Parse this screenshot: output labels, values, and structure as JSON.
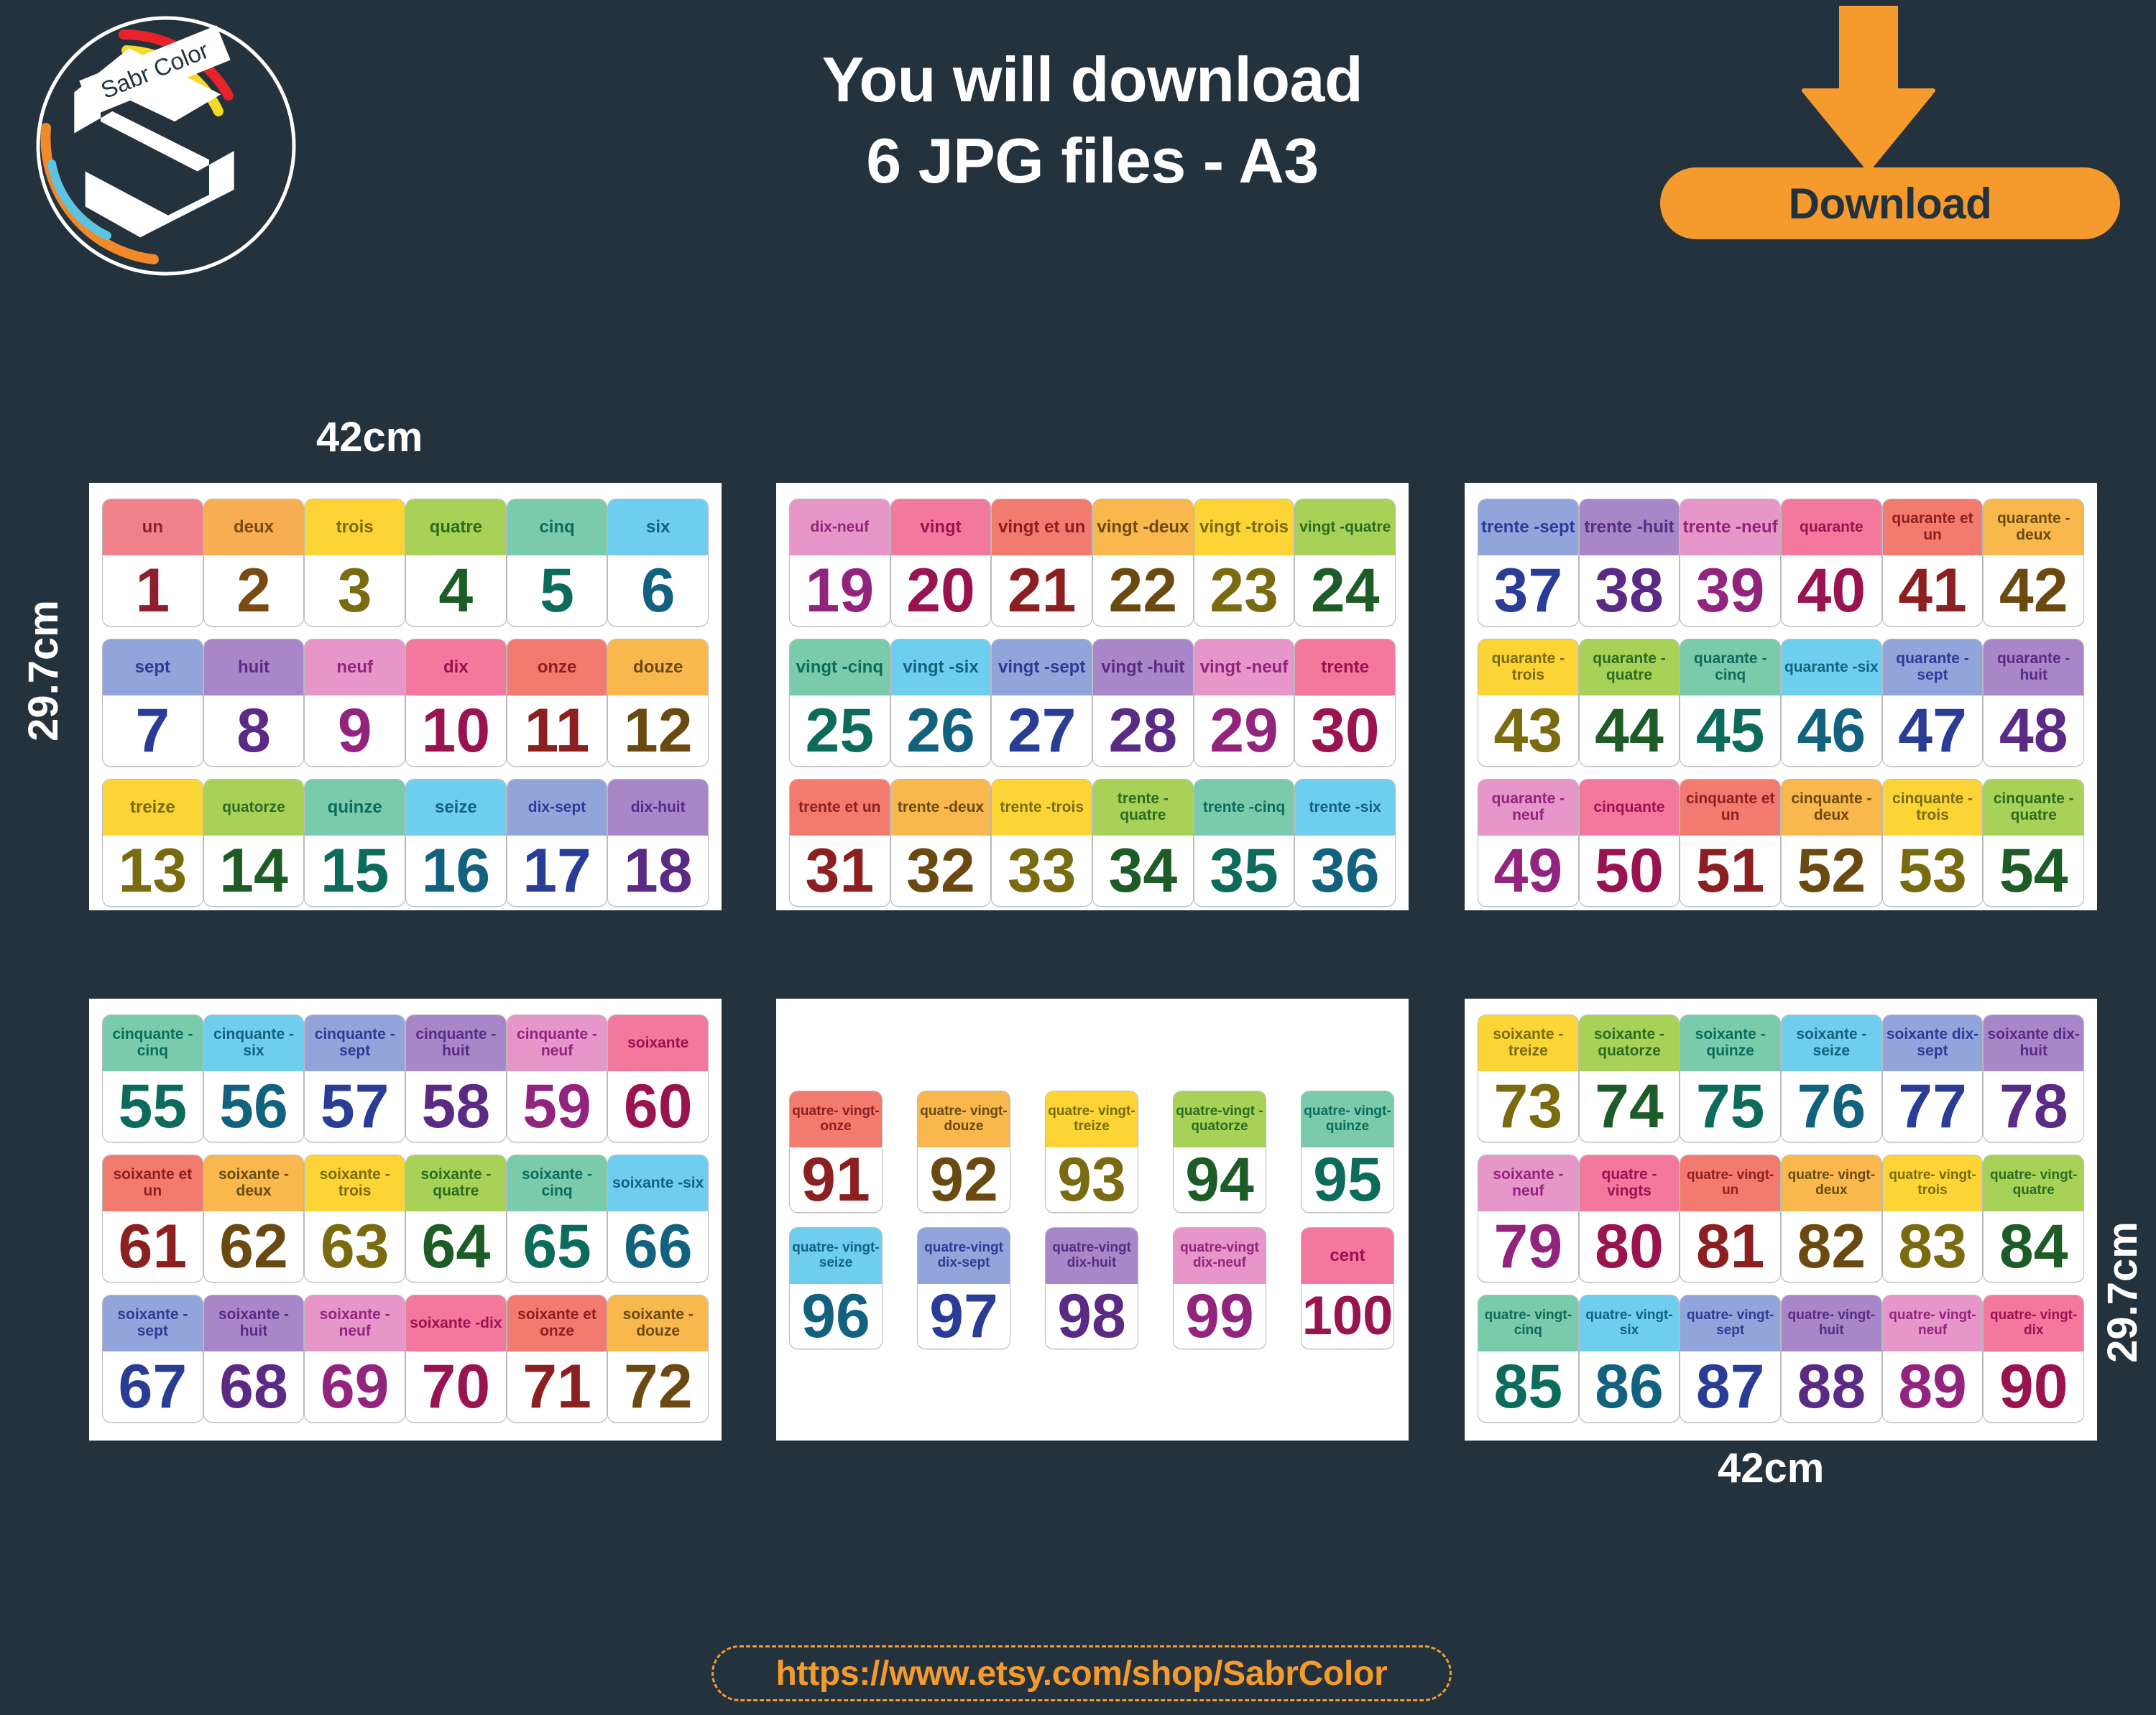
{
  "brand": {
    "logo_text": "Sabr Color",
    "logo_arc_colors": [
      "#e8242a",
      "#f5d828",
      "#f0892a",
      "#5cc4e0"
    ]
  },
  "header": {
    "line1": "You will download",
    "line2": "6 JPG files - A3"
  },
  "download": {
    "label": "Download",
    "button_color": "#f59a2c",
    "arrow_color": "#f59a2c"
  },
  "dimensions": {
    "top_left_width": "42cm",
    "left_height": "29.7cm",
    "bottom_right_width": "42cm",
    "right_height": "29.7cm"
  },
  "footer": {
    "url": "https://www.etsy.com/shop/SabrColor",
    "accent": "#f59a2c"
  },
  "palette": {
    "head_bg": [
      "#f0808a",
      "#f7ad52",
      "#fad535",
      "#a8d257",
      "#7acbab",
      "#6fcdee",
      "#92a5da",
      "#a886c8",
      "#e696c8",
      "#f2789e",
      "#f27a6e",
      "#f8b84e"
    ],
    "head_fg": [
      "#8e1f2d",
      "#7a4a12",
      "#7a6b10",
      "#2c6b22",
      "#0d6b5c",
      "#12627f",
      "#2a3d96",
      "#5a2a84",
      "#93247e",
      "#99134f",
      "#8c2020",
      "#6b4a11"
    ],
    "num_fg": [
      "#8e1f2d",
      "#7a4a12",
      "#7a6b10",
      "#1d5c26",
      "#0d6b5c",
      "#12627f",
      "#2a3d96",
      "#5a2a84",
      "#93247e",
      "#99134f",
      "#8c2020",
      "#6b4a11"
    ],
    "page_bg": "#23323c",
    "sheet_bg": "#ffffff"
  },
  "sheets": [
    {
      "id": "sheet-1",
      "rows": [
        [
          {
            "word": "un",
            "num": "1",
            "c": 0
          },
          {
            "word": "deux",
            "num": "2",
            "c": 1
          },
          {
            "word": "trois",
            "num": "3",
            "c": 2
          },
          {
            "word": "quatre",
            "num": "4",
            "c": 3
          },
          {
            "word": "cinq",
            "num": "5",
            "c": 4
          },
          {
            "word": "six",
            "num": "6",
            "c": 5
          }
        ],
        [
          {
            "word": "sept",
            "num": "7",
            "c": 6
          },
          {
            "word": "huit",
            "num": "8",
            "c": 7
          },
          {
            "word": "neuf",
            "num": "9",
            "c": 8
          },
          {
            "word": "dix",
            "num": "10",
            "c": 9
          },
          {
            "word": "onze",
            "num": "11",
            "c": 10
          },
          {
            "word": "douze",
            "num": "12",
            "c": 11
          }
        ],
        [
          {
            "word": "treize",
            "num": "13",
            "c": 2
          },
          {
            "word": "quatorze",
            "num": "14",
            "c": 3,
            "sz": "small"
          },
          {
            "word": "quinze",
            "num": "15",
            "c": 4
          },
          {
            "word": "seize",
            "num": "16",
            "c": 5
          },
          {
            "word": "dix-sept",
            "num": "17",
            "c": 6,
            "sz": "small"
          },
          {
            "word": "dix-huit",
            "num": "18",
            "c": 7,
            "sz": "small"
          }
        ]
      ]
    },
    {
      "id": "sheet-2",
      "rows": [
        [
          {
            "word": "dix-neuf",
            "num": "19",
            "c": 8,
            "sz": "small"
          },
          {
            "word": "vingt",
            "num": "20",
            "c": 9
          },
          {
            "word": "vingt et un",
            "num": "21",
            "c": 10
          },
          {
            "word": "vingt -deux",
            "num": "22",
            "c": 11
          },
          {
            "word": "vingt -trois",
            "num": "23",
            "c": 2
          },
          {
            "word": "vingt -quatre",
            "num": "24",
            "c": 3,
            "sz": "small"
          }
        ],
        [
          {
            "word": "vingt -cinq",
            "num": "25",
            "c": 4
          },
          {
            "word": "vingt -six",
            "num": "26",
            "c": 5
          },
          {
            "word": "vingt -sept",
            "num": "27",
            "c": 6
          },
          {
            "word": "vingt -huit",
            "num": "28",
            "c": 7
          },
          {
            "word": "vingt -neuf",
            "num": "29",
            "c": 8
          },
          {
            "word": "trente",
            "num": "30",
            "c": 9
          }
        ],
        [
          {
            "word": "trente et un",
            "num": "31",
            "c": 10,
            "sz": "small"
          },
          {
            "word": "trente -deux",
            "num": "32",
            "c": 11,
            "sz": "small"
          },
          {
            "word": "trente -trois",
            "num": "33",
            "c": 2,
            "sz": "small"
          },
          {
            "word": "trente -quatre",
            "num": "34",
            "c": 3,
            "sz": "small"
          },
          {
            "word": "trente -cinq",
            "num": "35",
            "c": 4,
            "sz": "small"
          },
          {
            "word": "trente -six",
            "num": "36",
            "c": 5,
            "sz": "small"
          }
        ]
      ]
    },
    {
      "id": "sheet-3",
      "rows": [
        [
          {
            "word": "trente -sept",
            "num": "37",
            "c": 6
          },
          {
            "word": "trente -huit",
            "num": "38",
            "c": 7
          },
          {
            "word": "trente -neuf",
            "num": "39",
            "c": 8
          },
          {
            "word": "quarante",
            "num": "40",
            "c": 9,
            "sz": "small"
          },
          {
            "word": "quarante et un",
            "num": "41",
            "c": 10,
            "sz": "small"
          },
          {
            "word": "quarante -deux",
            "num": "42",
            "c": 11,
            "sz": "small"
          }
        ],
        [
          {
            "word": "quarante -trois",
            "num": "43",
            "c": 2,
            "sz": "small"
          },
          {
            "word": "quarante -quatre",
            "num": "44",
            "c": 3,
            "sz": "small"
          },
          {
            "word": "quarante -cinq",
            "num": "45",
            "c": 4,
            "sz": "small"
          },
          {
            "word": "quarante -six",
            "num": "46",
            "c": 5,
            "sz": "small"
          },
          {
            "word": "quarante -sept",
            "num": "47",
            "c": 6,
            "sz": "small"
          },
          {
            "word": "quarante -huit",
            "num": "48",
            "c": 7,
            "sz": "small"
          }
        ],
        [
          {
            "word": "quarante -neuf",
            "num": "49",
            "c": 8,
            "sz": "small"
          },
          {
            "word": "cinquante",
            "num": "50",
            "c": 9,
            "sz": "small"
          },
          {
            "word": "cinquante et un",
            "num": "51",
            "c": 10,
            "sz": "small"
          },
          {
            "word": "cinquante -deux",
            "num": "52",
            "c": 11,
            "sz": "small"
          },
          {
            "word": "cinquante -trois",
            "num": "53",
            "c": 2,
            "sz": "small"
          },
          {
            "word": "cinquante -quatre",
            "num": "54",
            "c": 3,
            "sz": "small"
          }
        ]
      ]
    },
    {
      "id": "sheet-4",
      "rows": [
        [
          {
            "word": "cinquante -cinq",
            "num": "55",
            "c": 4,
            "sz": "small"
          },
          {
            "word": "cinquante -six",
            "num": "56",
            "c": 5,
            "sz": "small"
          },
          {
            "word": "cinquante -sept",
            "num": "57",
            "c": 6,
            "sz": "small"
          },
          {
            "word": "cinquante -huit",
            "num": "58",
            "c": 7,
            "sz": "small"
          },
          {
            "word": "cinquante -neuf",
            "num": "59",
            "c": 8,
            "sz": "small"
          },
          {
            "word": "soixante",
            "num": "60",
            "c": 9,
            "sz": "small"
          }
        ],
        [
          {
            "word": "soixante et un",
            "num": "61",
            "c": 10,
            "sz": "small"
          },
          {
            "word": "soixante -deux",
            "num": "62",
            "c": 11,
            "sz": "small"
          },
          {
            "word": "soixante -trois",
            "num": "63",
            "c": 2,
            "sz": "small"
          },
          {
            "word": "soixante -quatre",
            "num": "64",
            "c": 3,
            "sz": "small"
          },
          {
            "word": "soixante -cinq",
            "num": "65",
            "c": 4,
            "sz": "small"
          },
          {
            "word": "soixante -six",
            "num": "66",
            "c": 5,
            "sz": "small"
          }
        ],
        [
          {
            "word": "soixante -sept",
            "num": "67",
            "c": 6,
            "sz": "small"
          },
          {
            "word": "soixante -huit",
            "num": "68",
            "c": 7,
            "sz": "small"
          },
          {
            "word": "soixante -neuf",
            "num": "69",
            "c": 8,
            "sz": "small"
          },
          {
            "word": "soixante -dix",
            "num": "70",
            "c": 9,
            "sz": "small"
          },
          {
            "word": "soixante et onze",
            "num": "71",
            "c": 10,
            "sz": "small"
          },
          {
            "word": "soixante -douze",
            "num": "72",
            "c": 11,
            "sz": "small"
          }
        ]
      ]
    },
    {
      "id": "sheet-5",
      "rows": [
        [
          {
            "word": "quatre- vingt-onze",
            "num": "91",
            "c": 10,
            "sz": "tiny"
          },
          {
            "word": "quatre- vingt-douze",
            "num": "92",
            "c": 11,
            "sz": "tiny"
          },
          {
            "word": "quatre- vingt-treize",
            "num": "93",
            "c": 2,
            "sz": "tiny"
          },
          {
            "word": "quatre-vingt -quatorze",
            "num": "94",
            "c": 3,
            "sz": "tiny"
          },
          {
            "word": "quatre- vingt-quinze",
            "num": "95",
            "c": 4,
            "sz": "tiny"
          }
        ],
        [
          {
            "word": "quatre- vingt-seize",
            "num": "96",
            "c": 5,
            "sz": "tiny"
          },
          {
            "word": "quatre-vingt dix-sept",
            "num": "97",
            "c": 6,
            "sz": "tiny"
          },
          {
            "word": "quatre-vingt dix-huit",
            "num": "98",
            "c": 7,
            "sz": "tiny"
          },
          {
            "word": "quatre-vingt dix-neuf",
            "num": "99",
            "c": 8,
            "sz": "tiny"
          },
          {
            "word": "cent",
            "num": "100",
            "c": 9,
            "nsz": "narrow"
          }
        ]
      ]
    },
    {
      "id": "sheet-6",
      "rows": [
        [
          {
            "word": "soixante -treize",
            "num": "73",
            "c": 2,
            "sz": "small"
          },
          {
            "word": "soixante -quatorze",
            "num": "74",
            "c": 3,
            "sz": "small"
          },
          {
            "word": "soixante -quinze",
            "num": "75",
            "c": 4,
            "sz": "small"
          },
          {
            "word": "soixante -seize",
            "num": "76",
            "c": 5,
            "sz": "small"
          },
          {
            "word": "soixante dix-sept",
            "num": "77",
            "c": 6,
            "sz": "small"
          },
          {
            "word": "soixante dix-huit",
            "num": "78",
            "c": 7,
            "sz": "small"
          }
        ],
        [
          {
            "word": "soixante -neuf",
            "num": "79",
            "c": 8,
            "sz": "small"
          },
          {
            "word": "quatre -vingts",
            "num": "80",
            "c": 9,
            "sz": "small"
          },
          {
            "word": "quatre- vingt-un",
            "num": "81",
            "c": 10,
            "sz": "tiny"
          },
          {
            "word": "quatre- vingt-deux",
            "num": "82",
            "c": 11,
            "sz": "tiny"
          },
          {
            "word": "quatre- vingt-trois",
            "num": "83",
            "c": 2,
            "sz": "tiny"
          },
          {
            "word": "quatre- vingt-quatre",
            "num": "84",
            "c": 3,
            "sz": "tiny"
          }
        ],
        [
          {
            "word": "quatre- vingt-cinq",
            "num": "85",
            "c": 4,
            "sz": "tiny"
          },
          {
            "word": "quatre- vingt-six",
            "num": "86",
            "c": 5,
            "sz": "tiny"
          },
          {
            "word": "quatre- vingt-sept",
            "num": "87",
            "c": 6,
            "sz": "tiny"
          },
          {
            "word": "quatre- vingt-huit",
            "num": "88",
            "c": 7,
            "sz": "tiny"
          },
          {
            "word": "quatre- vingt-neuf",
            "num": "89",
            "c": 8,
            "sz": "tiny"
          },
          {
            "word": "quatre- vingt-dix",
            "num": "90",
            "c": 9,
            "sz": "tiny"
          }
        ]
      ]
    }
  ]
}
